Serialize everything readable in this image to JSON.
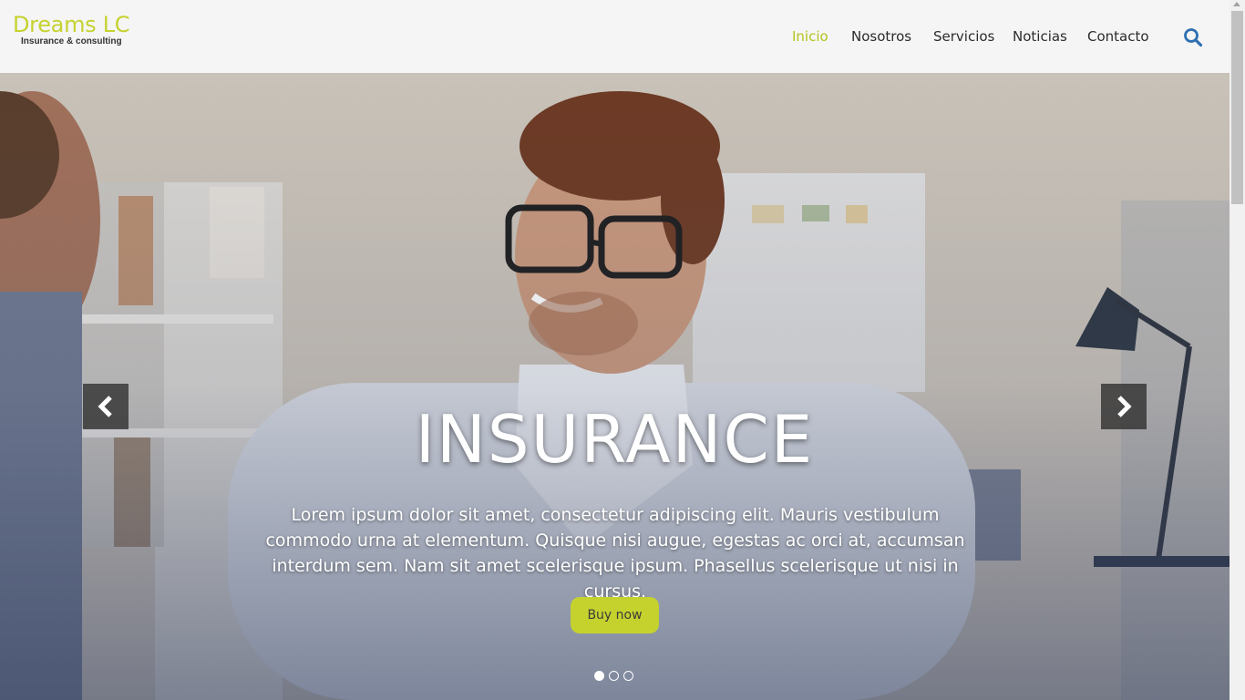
{
  "brand": {
    "name": "Dreams LC",
    "tagline": "Insurance & consulting",
    "accent_color": "#c5d22e"
  },
  "nav": {
    "items": [
      {
        "label": "Inicio",
        "active": true
      },
      {
        "label": "Nosotros",
        "active": false
      },
      {
        "label": "Servicios",
        "active": false
      },
      {
        "label": "Noticias",
        "active": false
      },
      {
        "label": "Contacto",
        "active": false
      }
    ],
    "search_icon": "search-icon"
  },
  "hero": {
    "title": "INSURANCE",
    "description": "Lorem ipsum dolor sit amet, consectetur adipiscing elit. Mauris vestibulum commodo urna at elementum. Quisque nisi augue, egestas ac orci at, accumsan interdum sem. Nam sit amet scelerisque ipsum. Phasellus scelerisque ut nisi in cursus.",
    "button_label": "Buy now",
    "prev_icon": "chevron-left-icon",
    "next_icon": "chevron-right-icon",
    "slides": 3,
    "active_slide": 1
  }
}
